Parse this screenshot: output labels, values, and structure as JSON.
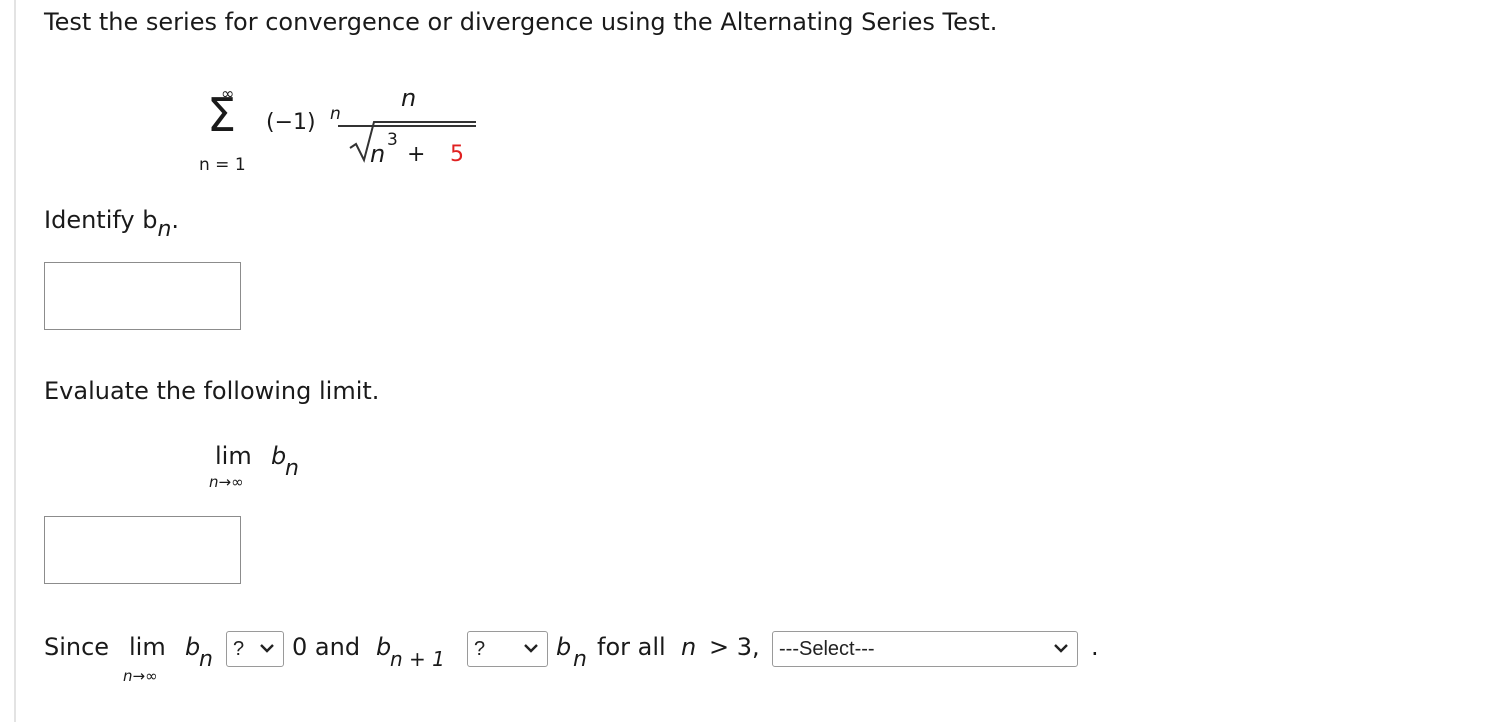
{
  "question": {
    "instruction": "Test the series for convergence or divergence using the Alternating Series Test."
  },
  "series": {
    "sigma": "Σ",
    "upper_limit": "∞",
    "lower_limit": "n = 1",
    "sign_factor_base": "(−1)",
    "sign_factor_exp": "n",
    "numerator": "n",
    "radicand_base": "n",
    "radicand_exp": "3",
    "radicand_plus": "+",
    "radicand_const": "5"
  },
  "identify": {
    "prompt": "Identify b",
    "sub": "n",
    "end": "."
  },
  "limit_section": {
    "prompt": "Evaluate the following limit.",
    "lim": "lim",
    "under": "n→∞",
    "b": "b",
    "sub": "n"
  },
  "since_line": {
    "since": "Since",
    "lim": "lim",
    "under": "n→∞",
    "b": "b",
    "sub_n": "n",
    "select1_value": "?",
    "zero_and": "0 and",
    "b2": "b",
    "sub_n_plus_1": "n + 1",
    "select2_value": "?",
    "b3": "b",
    "sub_n3": "n",
    "for_all": "for all",
    "n_var": "n",
    "condition": "> 3,",
    "select3_value": "---Select---",
    "period": "."
  },
  "colors": {
    "highlight_constant": "#e02020",
    "box_border": "#8c8c8c"
  }
}
